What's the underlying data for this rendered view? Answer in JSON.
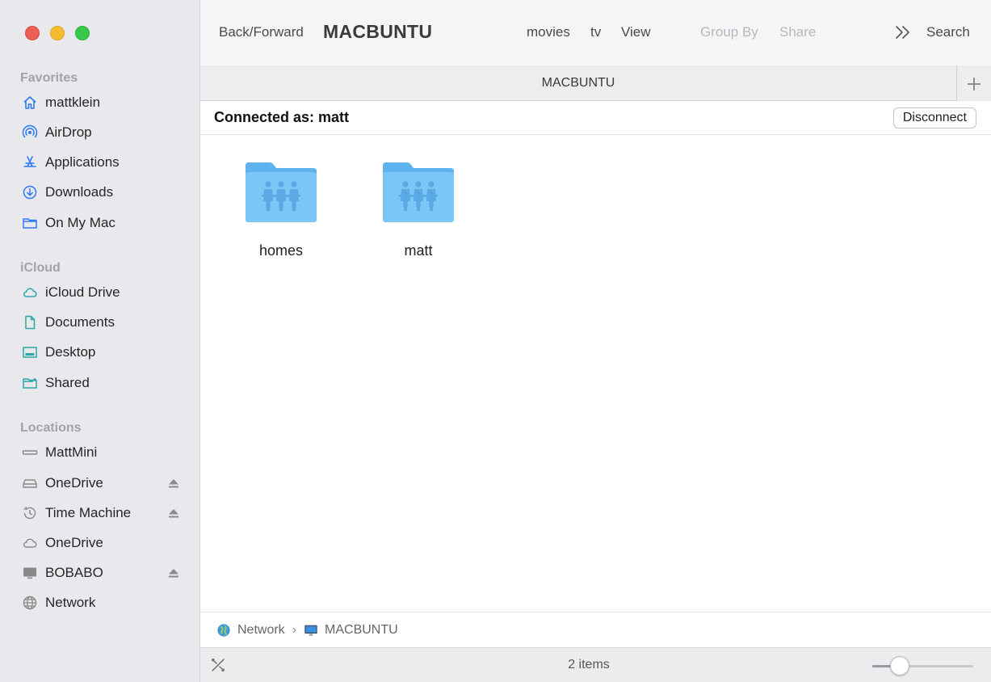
{
  "window": {
    "title": "MACBUNTU"
  },
  "toolbar": {
    "back_forward": "Back/Forward",
    "title": "MACBUNTU",
    "movies": "movies",
    "tv": "tv",
    "view": "View",
    "group_by": "Group By",
    "share": "Share",
    "search": "Search"
  },
  "tabbar": {
    "tab_label": "MACBUNTU",
    "add_icon": "plus-icon"
  },
  "connection": {
    "text": "Connected as: matt",
    "disconnect_label": "Disconnect"
  },
  "sidebar": {
    "favorites_header": "Favorites",
    "favorites": [
      {
        "label": "mattklein",
        "icon": "home-icon"
      },
      {
        "label": "AirDrop",
        "icon": "airdrop-icon"
      },
      {
        "label": "Applications",
        "icon": "applications-icon"
      },
      {
        "label": "Downloads",
        "icon": "download-icon"
      },
      {
        "label": "On My Mac",
        "icon": "folder-icon"
      }
    ],
    "icloud_header": "iCloud",
    "icloud": [
      {
        "label": "iCloud Drive",
        "icon": "cloud-icon"
      },
      {
        "label": "Documents",
        "icon": "document-icon"
      },
      {
        "label": "Desktop",
        "icon": "desktop-icon"
      },
      {
        "label": "Shared",
        "icon": "shared-folder-icon"
      }
    ],
    "locations_header": "Locations",
    "locations": [
      {
        "label": "MattMini",
        "icon": "computer-icon"
      },
      {
        "label": "OneDrive",
        "icon": "drive-icon"
      },
      {
        "label": "Time Machine",
        "icon": "time-machine-icon"
      },
      {
        "label": "OneDrive",
        "icon": "cloud-icon"
      },
      {
        "label": "BOBABO",
        "icon": "display-icon"
      },
      {
        "label": "Network",
        "icon": "globe-icon"
      }
    ]
  },
  "content": {
    "folders": [
      {
        "name": "homes",
        "icon": "shared-folder-icon"
      },
      {
        "name": "matt",
        "icon": "shared-folder-icon"
      }
    ]
  },
  "pathbar": {
    "segments": [
      {
        "label": "Network",
        "icon": "globe-icon"
      },
      {
        "label": "MACBUNTU",
        "icon": "display-icon"
      }
    ],
    "separator": "›"
  },
  "statusbar": {
    "item_count": "2 items",
    "icon_size_level": 0.27
  },
  "colors": {
    "accent": "#2f7bf6",
    "folder": "#74c0f5",
    "sidebar_bg": "#e9e8ec"
  }
}
